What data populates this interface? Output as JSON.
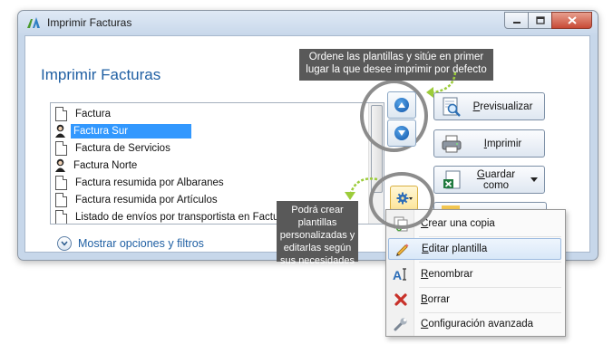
{
  "window": {
    "title": "Imprimir Facturas",
    "controls": {
      "minimize": "minimize-icon",
      "maximize": "maximize-icon",
      "close": "close-icon"
    }
  },
  "main": {
    "heading": "Imprimir Facturas",
    "templates": [
      {
        "label": "Factura",
        "icon": "document-icon",
        "selected": false
      },
      {
        "label": "Factura Sur",
        "icon": "person-icon",
        "selected": true
      },
      {
        "label": "Factura de Servicios",
        "icon": "document-icon",
        "selected": false
      },
      {
        "label": "Factura Norte",
        "icon": "person-icon",
        "selected": false
      },
      {
        "label": "Factura resumida por Albaranes",
        "icon": "document-icon",
        "selected": false
      },
      {
        "label": "Factura resumida por Artículos",
        "icon": "document-icon",
        "selected": false
      },
      {
        "label": "Listado de envíos por transportista en Facturas",
        "icon": "document-icon",
        "selected": false
      }
    ],
    "more_options": "Mostrar opciones y filtros"
  },
  "actions": {
    "preview": {
      "pre": "",
      "key": "P",
      "post": "revisualizar"
    },
    "print": {
      "pre": "",
      "key": "I",
      "post": "mprimir"
    },
    "save_as": {
      "pre": "",
      "key": "G",
      "post": "uardar como"
    }
  },
  "tooltips": {
    "order": "Ordene las plantillas y sitúe en primer lugar la que desee imprimir por defecto",
    "create": "Podrá crear plantillas personalizadas y editarlas según sus necesidades"
  },
  "context_menu": {
    "items": [
      {
        "pre": "",
        "key": "C",
        "post": "rear una copia",
        "icon": "copy-icon"
      },
      {
        "pre": "",
        "key": "E",
        "post": "ditar plantilla",
        "icon": "pencil-icon"
      },
      {
        "pre": "",
        "key": "R",
        "post": "enombrar",
        "icon": "rename-icon"
      },
      {
        "pre": "",
        "key": "B",
        "post": "orrar",
        "icon": "delete-icon"
      },
      {
        "pre": "",
        "key": "C",
        "post": "onfiguración avanzada",
        "icon": "wrench-icon"
      }
    ]
  },
  "colors": {
    "accent": "#1f5fa3",
    "selection": "#3298fe",
    "tooltip": "#595959",
    "arrow": "#9ccc3a"
  }
}
